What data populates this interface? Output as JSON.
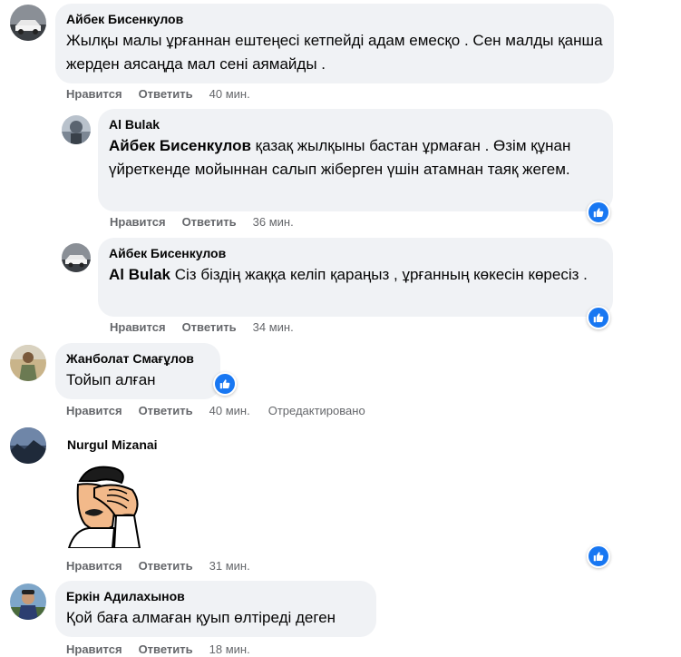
{
  "comments": [
    {
      "author": "Айбек Бисенкулов",
      "text": "Жылқы малы ұрғаннан ештеңесі кетпейді адам емесқо . Сен малды қанша жерден аясаңда мал сені аямайды .",
      "like_label": "Нравится",
      "reply_label": "Ответить",
      "time": "40 мин."
    },
    {
      "author": "Al Bulak",
      "mention": "Айбек Бисенкулов",
      "text": " қазақ жылқыны бастан ұрмаған . Өзім құнан үйреткенде мойыннан салып жіберген үшін атамнан таяқ жегем.",
      "like_label": "Нравится",
      "reply_label": "Ответить",
      "time": "36 мин."
    },
    {
      "author": "Айбек Бисенкулов",
      "mention": "Al Bulak",
      "text": " Сіз біздің жаққа келіп қараңыз , ұрғанның көкесін көресіз .",
      "like_label": "Нравится",
      "reply_label": "Ответить",
      "time": "34 мин."
    },
    {
      "author": "Жанболат Смағұлов",
      "text": "Тойып алған",
      "like_label": "Нравится",
      "reply_label": "Ответить",
      "time": "40 мин.",
      "edited": "Отредактировано"
    },
    {
      "author": "Nurgul Mizanai",
      "sticker": "facepalm-sticker",
      "like_label": "Нравится",
      "reply_label": "Ответить",
      "time": "31 мин."
    },
    {
      "author": "Еркін Адилахынов",
      "text": "Қой баға алмаған қуып өлтіреді деген",
      "like_label": "Нравится",
      "reply_label": "Ответить",
      "time": "18 мин."
    }
  ],
  "colors": {
    "bubble": "#f0f2f5",
    "meta": "#65676b",
    "like": "#1877f2"
  },
  "icons": {
    "like": "thumbs-up-icon"
  }
}
